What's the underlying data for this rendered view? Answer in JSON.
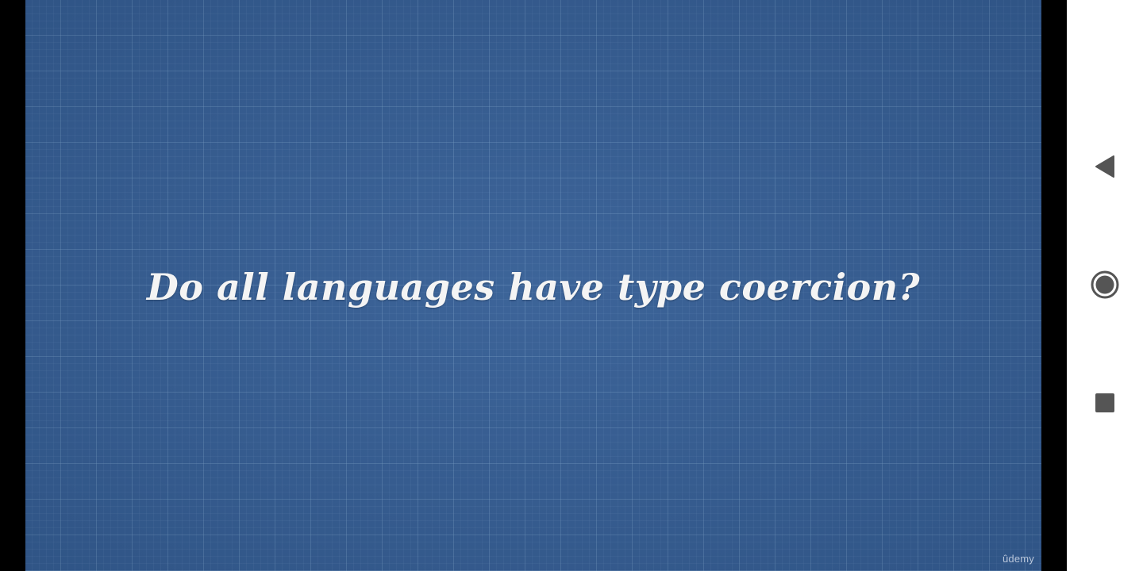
{
  "video": {
    "slide_title": "Do all languages have type coercion?",
    "watermark": "ûdemy",
    "background_color": "#355e95",
    "text_color": "#f4f4f4"
  },
  "navigation_bar": {
    "background_color": "#ffffff",
    "icon_color": "#555555",
    "buttons": [
      {
        "name": "back",
        "icon": "triangle-back-icon"
      },
      {
        "name": "home",
        "icon": "circle-home-icon"
      },
      {
        "name": "recents",
        "icon": "square-recents-icon"
      }
    ]
  }
}
